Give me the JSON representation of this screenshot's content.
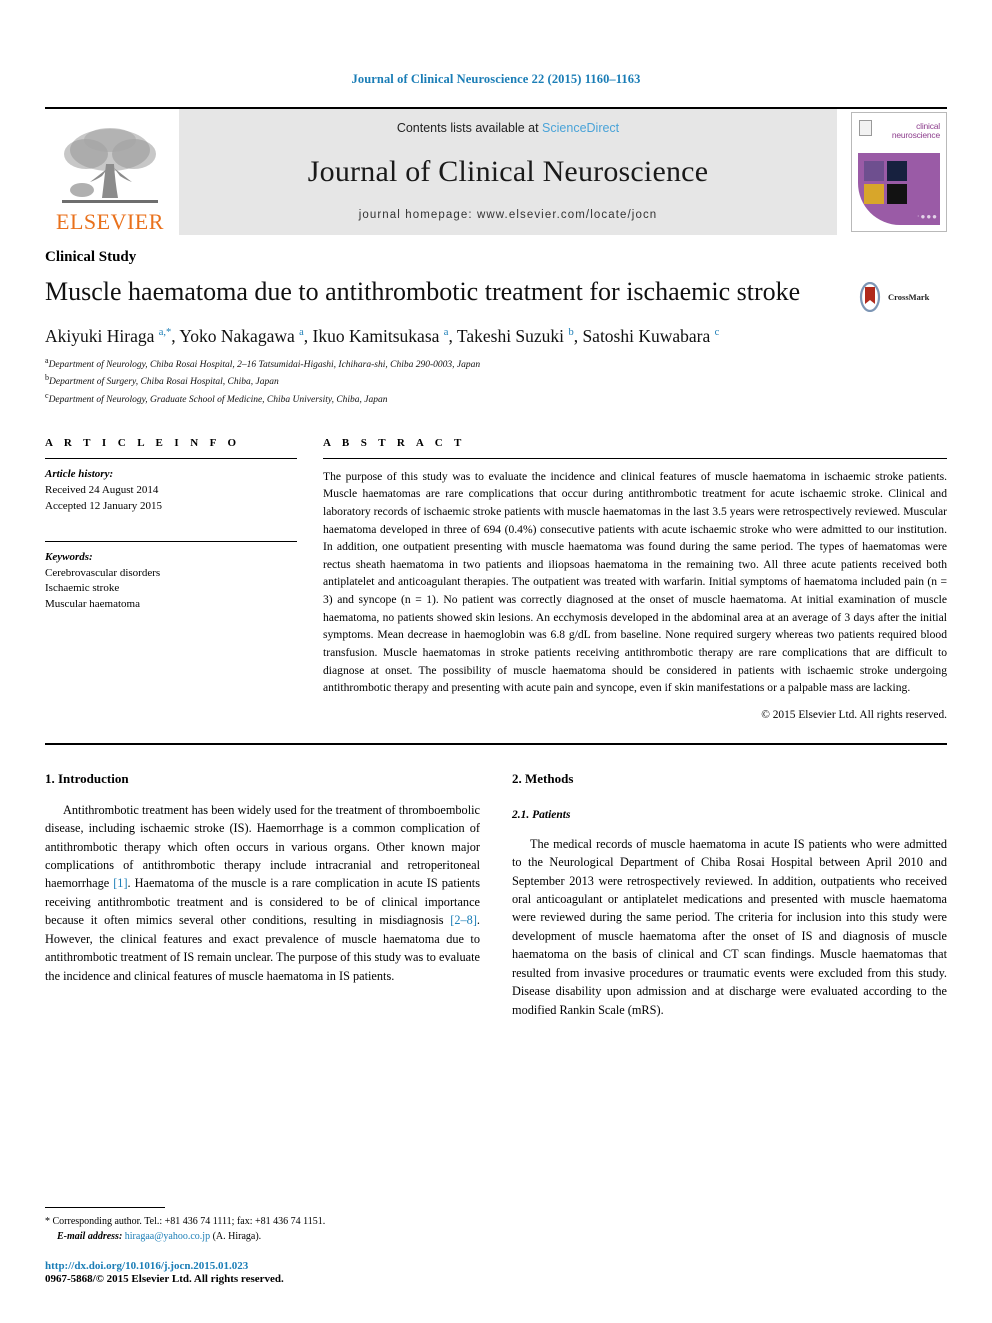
{
  "running_head": "Journal of Clinical Neuroscience 22 (2015) 1160–1163",
  "masthead": {
    "publisher_name": "ELSEVIER",
    "contents_prefix": "Contents lists available at ",
    "sciencedirect": "ScienceDirect",
    "journal_title": "Journal of Clinical Neuroscience",
    "homepage": "journal homepage: www.elsevier.com/locate/jocn",
    "cover": {
      "brand_line1": "clinical",
      "brand_line2": "neuroscience",
      "dots": "·●●●"
    }
  },
  "article": {
    "section_type": "Clinical Study",
    "title": "Muscle haematoma due to antithrombotic treatment for ischaemic stroke",
    "crossmark_label": "CrossMark",
    "authors_html": "Akiyuki Hiraga <sup>a,*</sup>, Yoko Nakagawa <sup>a</sup>, Ikuo Kamitsukasa <sup>a</sup>, Takeshi Suzuki <sup>b</sup>, Satoshi Kuwabara <sup>c</sup>",
    "affiliations": [
      "Department of Neurology, Chiba Rosai Hospital, 2–16 Tatsumidai-Higashi, Ichihara-shi, Chiba 290-0003, Japan",
      "Department of Surgery, Chiba Rosai Hospital, Chiba, Japan",
      "Department of Neurology, Graduate School of Medicine, Chiba University, Chiba, Japan"
    ],
    "affiliation_marks": [
      "a",
      "b",
      "c"
    ]
  },
  "article_info": {
    "heading": "A R T I C L E    I N F O",
    "history_label": "Article history:",
    "received": "Received 24 August 2014",
    "accepted": "Accepted 12 January 2015",
    "keywords_label": "Keywords:",
    "keywords": [
      "Cerebrovascular disorders",
      "Ischaemic stroke",
      "Muscular haematoma"
    ]
  },
  "abstract": {
    "heading": "A B S T R A C T",
    "text": "The purpose of this study was to evaluate the incidence and clinical features of muscle haematoma in ischaemic stroke patients. Muscle haematomas are rare complications that occur during antithrombotic treatment for acute ischaemic stroke. Clinical and laboratory records of ischaemic stroke patients with muscle haematomas in the last 3.5 years were retrospectively reviewed. Muscular haematoma developed in three of 694 (0.4%) consecutive patients with acute ischaemic stroke who were admitted to our institution. In addition, one outpatient presenting with muscle haematoma was found during the same period. The types of haematomas were rectus sheath haematoma in two patients and iliopsoas haematoma in the remaining two. All three acute patients received both antiplatelet and anticoagulant therapies. The outpatient was treated with warfarin. Initial symptoms of haematoma included pain (n = 3) and syncope (n = 1). No patient was correctly diagnosed at the onset of muscle haematoma. At initial examination of muscle haematoma, no patients showed skin lesions. An ecchymosis developed in the abdominal area at an average of 3 days after the initial symptoms. Mean decrease in haemoglobin was 6.8 g/dL from baseline. None required surgery whereas two patients required blood transfusion. Muscle haematomas in stroke patients receiving antithrombotic therapy are rare complications that are difficult to diagnose at onset. The possibility of muscle haematoma should be considered in patients with ischaemic stroke undergoing antithrombotic therapy and presenting with acute pain and syncope, even if skin manifestations or a palpable mass are lacking.",
    "copyright": "© 2015 Elsevier Ltd. All rights reserved."
  },
  "sections": {
    "introduction": {
      "heading": "1. Introduction",
      "para_1a": "Antithrombotic treatment has been widely used for the treatment of thromboembolic disease, including ischaemic stroke (IS). Haemorrhage is a common complication of antithrombotic therapy which often occurs in various organs. Other known major complications of antithrombotic therapy include intracranial and retroperitoneal haemorrhage ",
      "ref_1": "[1]",
      "para_1b": ". Haematoma of the muscle is a rare complication in acute IS patients receiving antithrombotic treatment and is considered to be of clinical importance because it often mimics several other conditions, resulting in misdiagnosis ",
      "ref_2": "[2–8]",
      "para_1c": ". However, the clinical features and exact prevalence of muscle haematoma due to antithrombotic treatment of IS remain unclear. The purpose of this study was to evaluate the incidence and clinical features of muscle haematoma in IS patients."
    },
    "methods": {
      "heading": "2. Methods",
      "sub_heading": "2.1. Patients",
      "para": "The medical records of muscle haematoma in acute IS patients who were admitted to the Neurological Department of Chiba Rosai Hospital between April 2010 and September 2013 were retrospectively reviewed. In addition, outpatients who received oral anticoagulant or antiplatelet medications and presented with muscle haematoma were reviewed during the same period. The criteria for inclusion into this study were development of muscle haematoma after the onset of IS and diagnosis of muscle haematoma on the basis of clinical and CT scan findings. Muscle haematomas that resulted from invasive procedures or traumatic events were excluded from this study. Disease disability upon admission and at discharge were evaluated according to the modified Rankin Scale (mRS)."
    }
  },
  "footer": {
    "corresponding_marker": "*",
    "corresponding_text": "Corresponding author. Tel.: +81 436 74 1111; fax: +81 436 74 1151.",
    "email_label": "E-mail address:",
    "email": "hiragaa@yahoo.co.jp",
    "email_suffix": " (A. Hiraga).",
    "doi": "http://dx.doi.org/10.1016/j.jocn.2015.01.023",
    "issn": "0967-5868/© 2015 Elsevier Ltd. All rights reserved."
  },
  "colors": {
    "link_blue": "#1a7db6",
    "sciencedirect_blue": "#4aa3d8",
    "elsevier_orange": "#E9711C",
    "cover_purple": "#9a5ba6",
    "crossmark_red": "#b02a1c"
  }
}
